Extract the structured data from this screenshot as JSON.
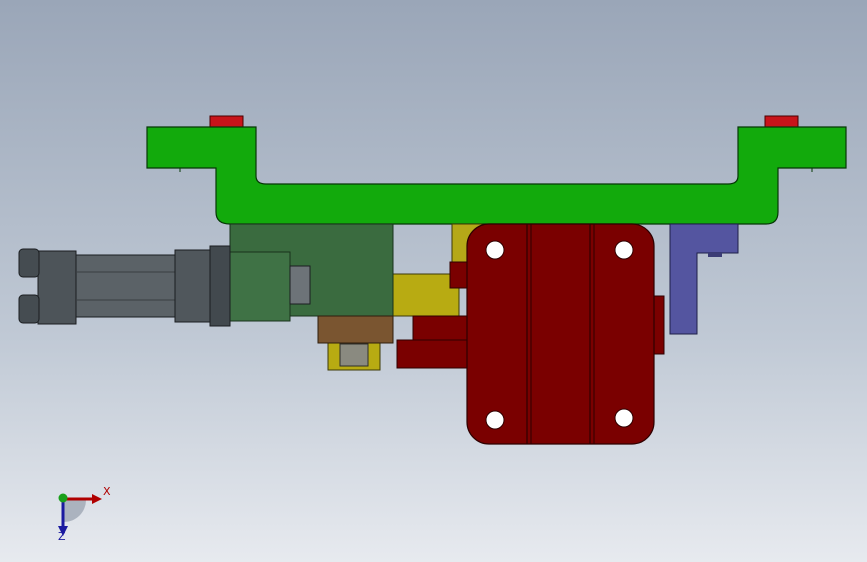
{
  "viewport": {
    "background_top": "#9aa6b8",
    "background_bottom": "#e7eaef"
  },
  "model": {
    "parts": [
      {
        "name": "mounting-bracket",
        "color": "#15a80f"
      },
      {
        "name": "locating-pin",
        "color": "#c8141a"
      },
      {
        "name": "air-cylinder",
        "color": "#545b61"
      },
      {
        "name": "cylinder-mount-block",
        "color": "#3a6b3f"
      },
      {
        "name": "slide-block",
        "color": "#b8ab12"
      },
      {
        "name": "gripper-housing",
        "color": "#7a0000"
      },
      {
        "name": "side-plate",
        "color": "#5455a0"
      },
      {
        "name": "brown-block",
        "color": "#7a5530"
      }
    ]
  },
  "triad": {
    "x_label": "X",
    "z_label": "Z",
    "x_color": "#b00000",
    "z_color": "#1a1aa0",
    "y_color": "#1aa01a"
  }
}
